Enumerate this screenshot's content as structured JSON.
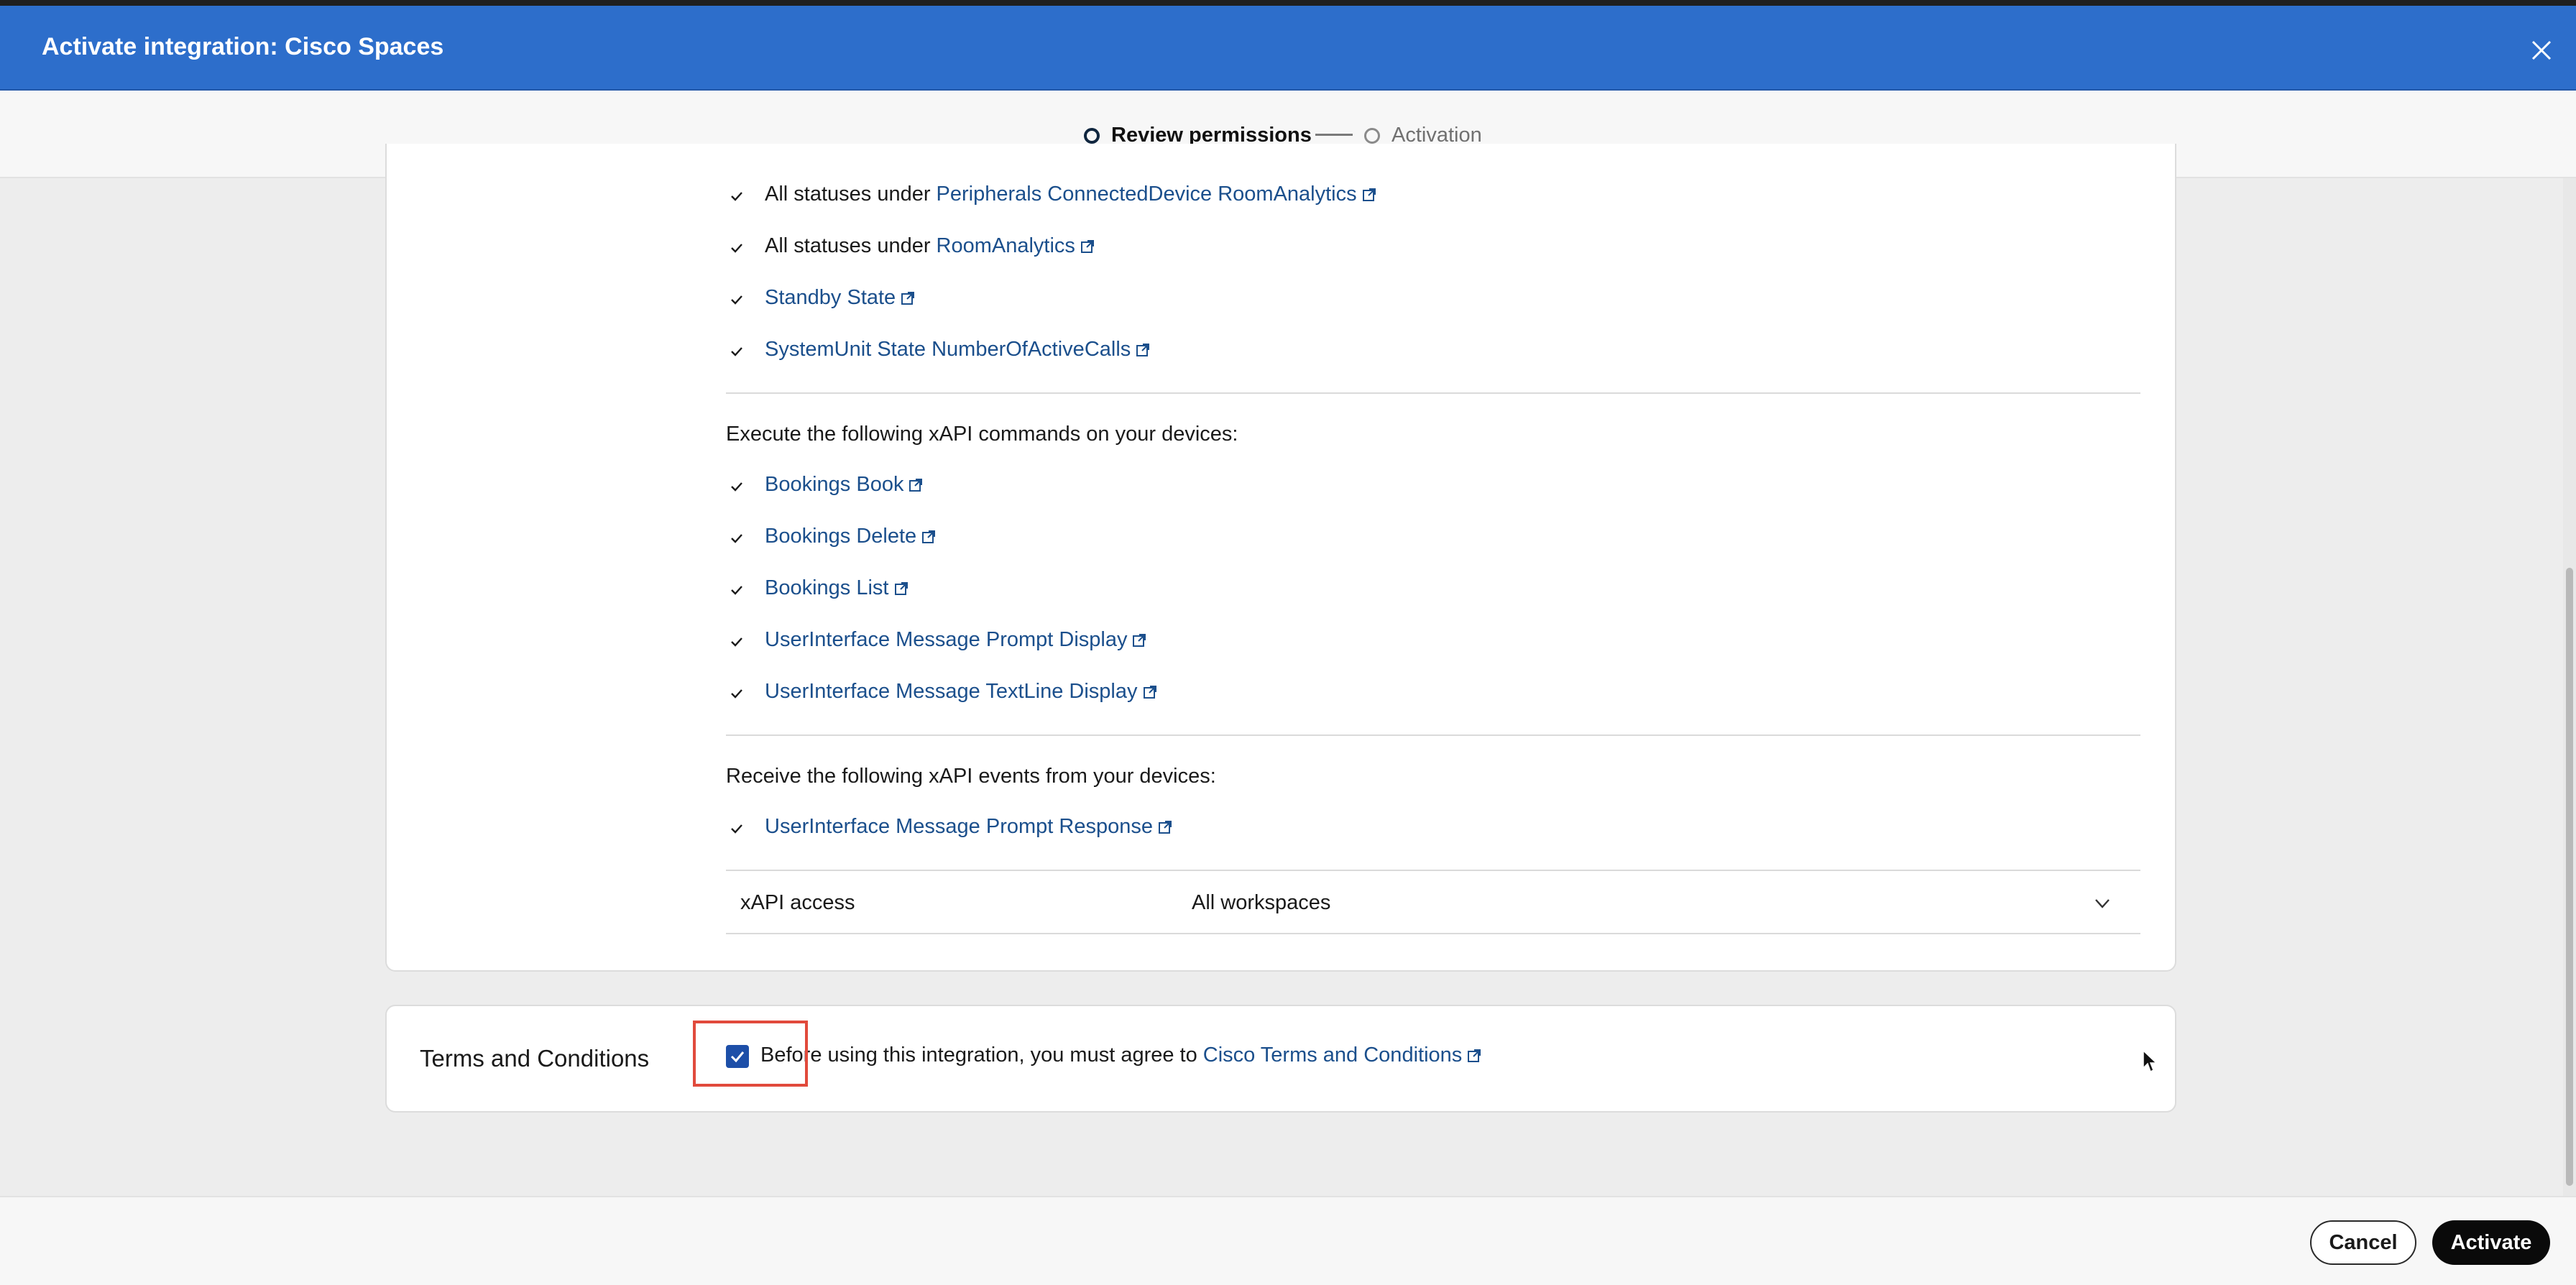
{
  "window": {
    "title": "Activate integration: Cisco Spaces"
  },
  "stepper": {
    "step1": "Review permissions",
    "step2": "Activation"
  },
  "status_items": [
    {
      "prefix": "All statuses under",
      "link": "Peripherals ConnectedDevice RoomAnalytics"
    },
    {
      "prefix": "All statuses under",
      "link": "RoomAnalytics"
    },
    {
      "prefix": "",
      "link": "Standby State"
    },
    {
      "prefix": "",
      "link": "SystemUnit State NumberOfActiveCalls"
    }
  ],
  "commands": {
    "heading": "Execute the following xAPI commands on your devices:",
    "items": [
      "Bookings Book",
      "Bookings Delete",
      "Bookings List",
      "UserInterface Message Prompt Display",
      "UserInterface Message TextLine Display"
    ]
  },
  "events": {
    "heading": "Receive the following xAPI events from your devices:",
    "items": [
      "UserInterface Message Prompt Response"
    ]
  },
  "xapi_access": {
    "label": "xAPI access",
    "value": "All workspaces"
  },
  "terms": {
    "title": "Terms and Conditions",
    "text": "Before using this integration, you must agree to",
    "link": "Cisco Terms and Conditions",
    "checked": true
  },
  "footer": {
    "cancel": "Cancel",
    "activate": "Activate"
  },
  "colors": {
    "header": "#2d6ecb",
    "link": "#1b4f8c",
    "highlight": "#e14a3c",
    "checkbox": "#1d4fa8"
  }
}
